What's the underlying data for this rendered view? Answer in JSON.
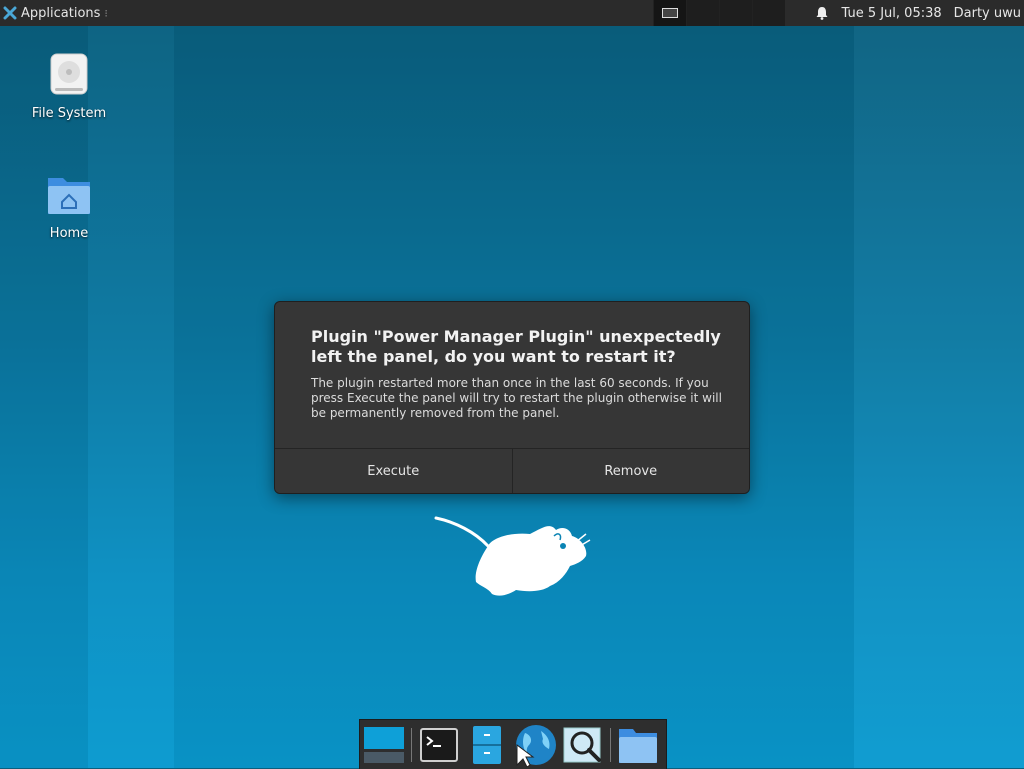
{
  "top_panel": {
    "applications_label": "Applications",
    "applications_icon": "xfce-logo-icon",
    "clock": "Tue  5 Jul, 05:38",
    "user": "Darty uwu",
    "notification_icon": "bell-icon"
  },
  "desktop": {
    "icons": [
      {
        "label": "File System",
        "icon": "drive-icon"
      },
      {
        "label": "Home",
        "icon": "home-folder-icon"
      }
    ]
  },
  "dialog": {
    "title": "Plugin \"Power Manager Plugin\" unexpectedly left the panel, do you want to restart it?",
    "message": "The plugin restarted more than once in the last 60 seconds. If you press Execute the panel will try to restart the plugin otherwise it will be permanently removed from the panel.",
    "execute_label": "Execute",
    "remove_label": "Remove"
  },
  "dock": {
    "items": [
      "desktop-icon",
      "terminal-icon",
      "file-cabinet-icon",
      "web-browser-icon",
      "app-finder-icon",
      "folder-icon"
    ]
  },
  "colors": {
    "panel_bg": "#2b2b2b",
    "dialog_bg": "#363636",
    "desktop_blue": "#0b8fc2"
  }
}
